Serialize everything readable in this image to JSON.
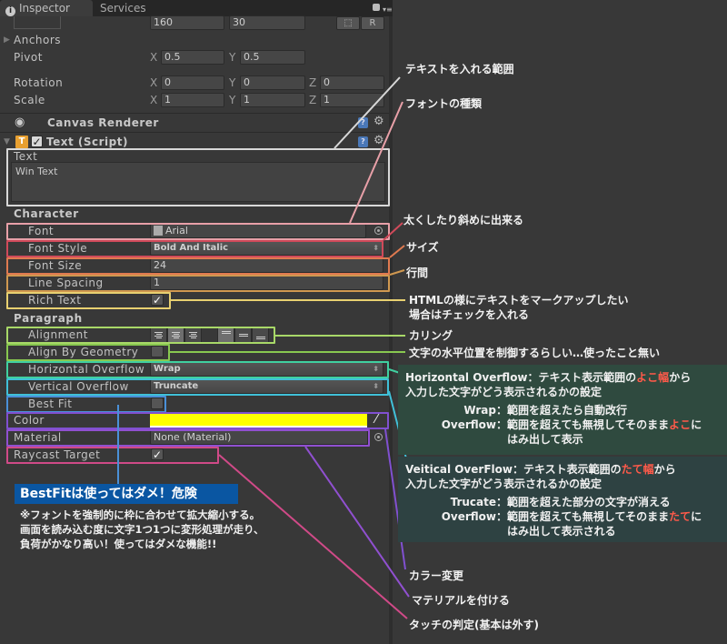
{
  "tabs": [
    {
      "label": "Inspector",
      "active": true
    },
    {
      "label": "Services",
      "active": false
    }
  ],
  "rect_transform": {
    "size": {
      "width": "160",
      "height": "30"
    },
    "buttons": {
      "blueprint": "⬚",
      "raw": "R"
    },
    "anchors_label": "Anchors",
    "pivot": {
      "label": "Pivot",
      "x": "0.5",
      "y": "0.5"
    },
    "rotation": {
      "label": "Rotation",
      "x": "0",
      "y": "0",
      "z": "0"
    },
    "scale": {
      "label": "Scale",
      "x": "1",
      "y": "1",
      "z": "1"
    },
    "axes": {
      "x": "X",
      "y": "Y",
      "z": "Z"
    }
  },
  "components": {
    "canvas_renderer": {
      "title": "Canvas Renderer"
    },
    "text_script": {
      "title": "Text (Script)",
      "enabled": true
    }
  },
  "text_field": {
    "label": "Text",
    "value": "Win Text"
  },
  "character": {
    "header": "Character",
    "font": {
      "label": "Font",
      "value": "Arial"
    },
    "font_style": {
      "label": "Font Style",
      "value": "Bold And Italic"
    },
    "font_size": {
      "label": "Font Size",
      "value": "24"
    },
    "line_spacing": {
      "label": "Line Spacing",
      "value": "1"
    },
    "rich_text": {
      "label": "Rich Text",
      "checked": true,
      "mark": "✓"
    }
  },
  "paragraph": {
    "header": "Paragraph",
    "alignment": {
      "label": "Alignment",
      "horizontal_selected": "center",
      "vertical_selected": "top"
    },
    "align_by_geometry": {
      "label": "Align By Geometry",
      "checked": false
    },
    "horizontal_overflow": {
      "label": "Horizontal Overflow",
      "value": "Wrap"
    },
    "vertical_overflow": {
      "label": "Vertical Overflow",
      "value": "Truncate"
    },
    "best_fit": {
      "label": "Best Fit",
      "checked": false
    }
  },
  "color": {
    "label": "Color",
    "value": "#ffff00"
  },
  "material": {
    "label": "Material",
    "value": "None (Material)"
  },
  "raycast_target": {
    "label": "Raycast Target",
    "checked": true,
    "mark": "✓"
  },
  "annotations": {
    "text_area": "テキストを入れる範囲",
    "font": "フォントの種類",
    "font_style": "太くしたり斜めに出来る",
    "font_size": "サイズ",
    "line_spacing": "行間",
    "rich_text_1": "HTMLの様にテキストをマークアップしたい",
    "rich_text_2": "場合はチェックを入れる",
    "alignment": "カリング",
    "align_by_geometry": "文字の水平位置を制御するらしい…使ったこと無い",
    "horizontal_overflow": {
      "line1_a": "Horizontal Overflow：テキスト表示範囲の",
      "line1_red": "よこ幅",
      "line1_b": "から",
      "line2": "入力した文字がどう表示されるかの設定",
      "wrap_key": "Wrap：",
      "wrap_val": "範囲を超えたら自動改行",
      "overflow_key": "Overflow：",
      "overflow_val_a": "範囲を超えても無視してそのまま",
      "overflow_val_red": "よこ",
      "overflow_val_b": "に",
      "overflow_val_2": "はみ出して表示"
    },
    "vertical_overflow": {
      "line1_a": "Veitical OverFlow：テキスト表示範囲の",
      "line1_red": "たて幅",
      "line1_b": "から",
      "line2": "入力した文字がどう表示されるかの設定",
      "truncate_key": "Trucate：",
      "truncate_val": "範囲を超えた部分の文字が消える",
      "overflow_key": "Overflow：",
      "overflow_val_a": "範囲を超えても無視してそのまま",
      "overflow_val_red": "たて",
      "overflow_val_b": "に",
      "overflow_val_2": "はみ出して表示される"
    },
    "color": "カラー変更",
    "material": "マテリアルを付ける",
    "raycast": "タッチの判定(基本は外す)",
    "best_fit_warning_title": "BestFitは使ってはダメ！危険",
    "best_fit_warning_lines": [
      "※フォントを強制的に枠に合わせて拡大縮小する。",
      "画面を読み込む度に文字1つ1つに変形処理が走り、",
      "負荷がかなり高い！使ってはダメな機能!!"
    ]
  },
  "colors": {
    "text_area": "#d8d8d8",
    "font": "#e8a0a8",
    "font_style": "#d04a5a",
    "font_size": "#e07a50",
    "line_spacing": "#d09850",
    "rich_text": "#e8d070",
    "alignment": "#a8d868",
    "align_by_geometry": "#88c850",
    "horizontal_overflow": "#40d0a0",
    "vertical_overflow": "#40c0d8",
    "best_fit": "#4a90d8",
    "color": "#8050d0",
    "material": "#9050d0",
    "raycast": "#d04a88",
    "highlight_red": "#ff5a4a",
    "warning_bg": "#0a56a2"
  }
}
